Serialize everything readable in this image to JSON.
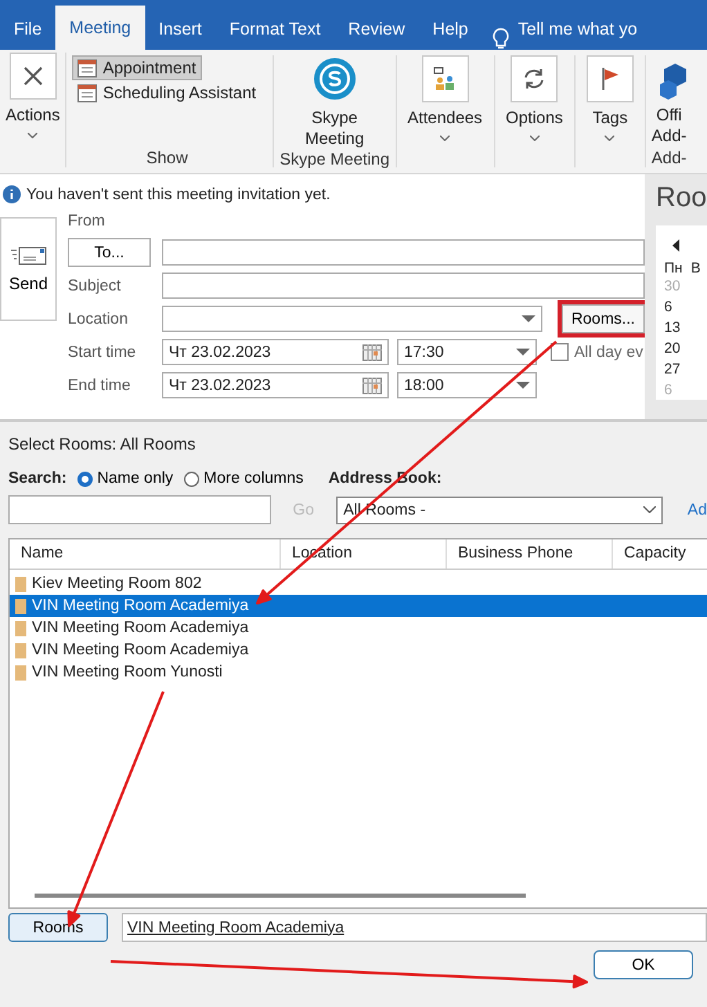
{
  "tabs": [
    {
      "label": "File",
      "selected": false
    },
    {
      "label": "Meeting",
      "selected": true
    },
    {
      "label": "Insert",
      "selected": false
    },
    {
      "label": "Format Text",
      "selected": false
    },
    {
      "label": "Review",
      "selected": false
    },
    {
      "label": "Help",
      "selected": false
    }
  ],
  "tell_me": "Tell me what yo",
  "ribbon": {
    "actions": "Actions",
    "show_items": [
      {
        "label": "Appointment",
        "selected": true
      },
      {
        "label": "Scheduling Assistant",
        "selected": false
      }
    ],
    "show_label": "Show",
    "skype": [
      "Skype",
      "Meeting"
    ],
    "skype_label": "Skype Meeting",
    "attendees": "Attendees",
    "options": "Options",
    "tags": "Tags",
    "addins": [
      "Offi",
      "Add-"
    ],
    "addins_label": "Add-"
  },
  "form": {
    "info": "You haven't sent this meeting invitation yet.",
    "send": "Send",
    "from_label": "From",
    "to_button": "To...",
    "subject_label": "Subject",
    "location_label": "Location",
    "rooms_button": {
      "label": "Rooms...",
      "highlighted": true
    },
    "start_label": "Start time",
    "start_date": "Чт 23.02.2023",
    "start_time": "17:30",
    "all_day": {
      "label": "All day ev",
      "checked": false
    },
    "end_label": "End time",
    "end_date": "Чт 23.02.2023",
    "end_time": "18:00"
  },
  "side": {
    "title": "Roo",
    "weekdays": [
      "Пн",
      "В"
    ],
    "days": [
      {
        "label": "30",
        "other_month": true
      },
      {
        "label": "6",
        "other_month": false
      },
      {
        "label": "13",
        "other_month": false
      },
      {
        "label": "20",
        "other_month": false
      },
      {
        "label": "27",
        "other_month": false
      },
      {
        "label": "6",
        "other_month": true
      }
    ]
  },
  "dialog": {
    "title": "Select Rooms: All Rooms",
    "search_label": "Search:",
    "radios": [
      {
        "label": "Name only",
        "selected": true
      },
      {
        "label": "More columns",
        "selected": false
      }
    ],
    "address_book_label": "Address Book:",
    "go_button": {
      "label": "Go",
      "disabled": true
    },
    "address_book": "All Rooms -",
    "advanced": "Ad",
    "columns": [
      "Name",
      "Location",
      "Business Phone",
      "Capacity"
    ],
    "rows": [
      {
        "name": "Kiev Meeting Room 802",
        "selected": false
      },
      {
        "name": "VIN Meeting Room Academiya",
        "selected": true
      },
      {
        "name": "VIN Meeting Room Academiya",
        "selected": false
      },
      {
        "name": "VIN Meeting Room Academiya",
        "selected": false
      },
      {
        "name": "VIN Meeting Room Yunosti",
        "selected": false
      }
    ],
    "rooms_button": "Rooms",
    "rooms_value": "VIN Meeting Room Academiya",
    "ok_button": "OK"
  }
}
